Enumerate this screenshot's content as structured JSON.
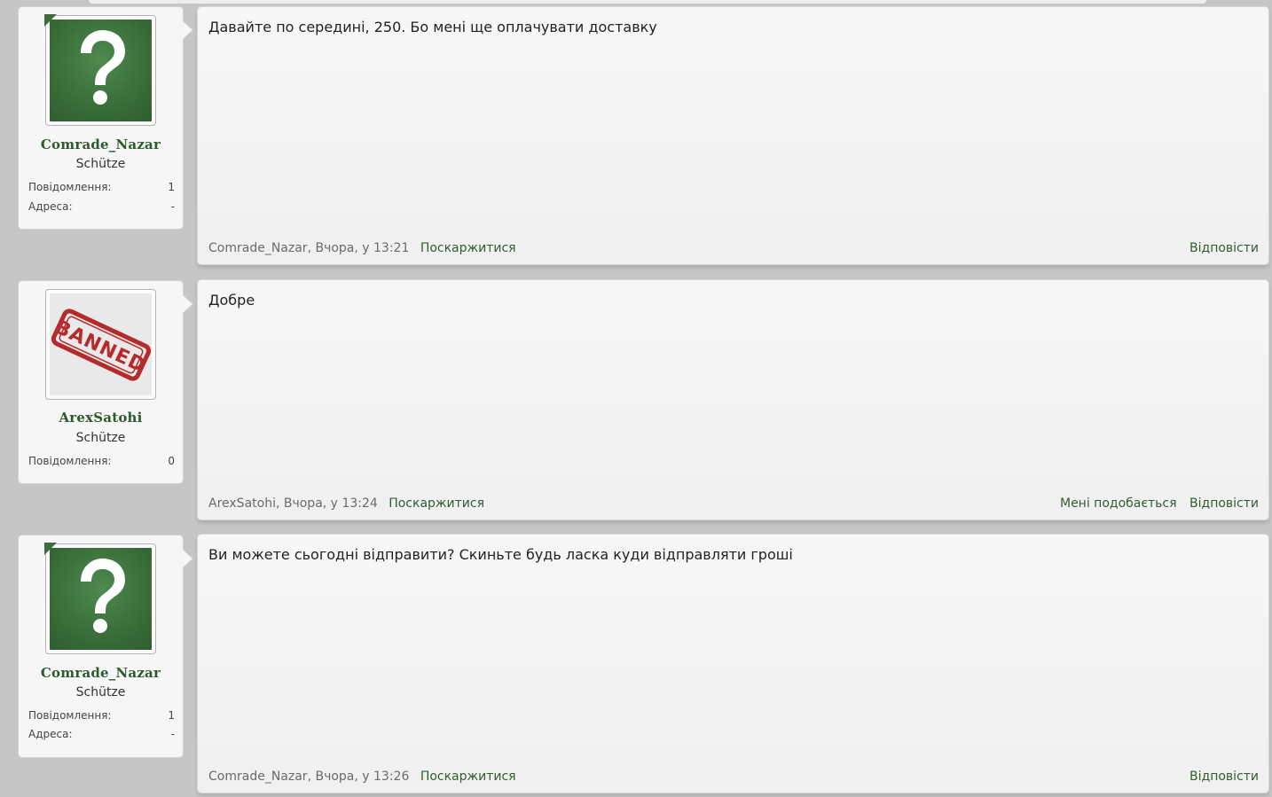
{
  "posts": [
    {
      "user": {
        "name": "Comrade_Nazar",
        "rank": "Schütze",
        "avatar": "question-mark-avatar",
        "stats": [
          {
            "label": "Повідомлення:",
            "value": "1"
          },
          {
            "label": "Адреса:",
            "value": "-"
          }
        ]
      },
      "message": "Давайте по середині, 250. Бо мені ще оплачувати доставку",
      "meta": {
        "author": "Comrade_Nazar",
        "time": ", Вчора, у 13:21",
        "report": "Поскаржитися"
      },
      "actions": {
        "reply": "Відповісти"
      }
    },
    {
      "user": {
        "name": "ArexSatohi",
        "rank": "Schütze",
        "avatar": "banned-stamp-avatar",
        "avatar_text": "BANNED",
        "stats": [
          {
            "label": "Повідомлення:",
            "value": "0"
          }
        ]
      },
      "message": "Добре",
      "meta": {
        "author": "ArexSatohi",
        "time": ", Вчора, у 13:24",
        "report": "Поскаржитися"
      },
      "actions": {
        "like": "Мені подобається",
        "reply": "Відповісти"
      }
    },
    {
      "user": {
        "name": "Comrade_Nazar",
        "rank": "Schütze",
        "avatar": "question-mark-avatar",
        "stats": [
          {
            "label": "Повідомлення:",
            "value": "1"
          },
          {
            "label": "Адреса:",
            "value": "-"
          }
        ]
      },
      "message": "Ви можете сьогодні відправити? Скиньте будь ласка куди відправляти гроші",
      "meta": {
        "author": "Comrade_Nazar",
        "time": ", Вчора, у 13:26",
        "report": "Поскаржитися"
      },
      "actions": {
        "reply": "Відповісти"
      }
    }
  ],
  "colors": {
    "accent": "#2e5e2e",
    "username": "#2d5a2d",
    "stamp": "#b52a2a"
  }
}
